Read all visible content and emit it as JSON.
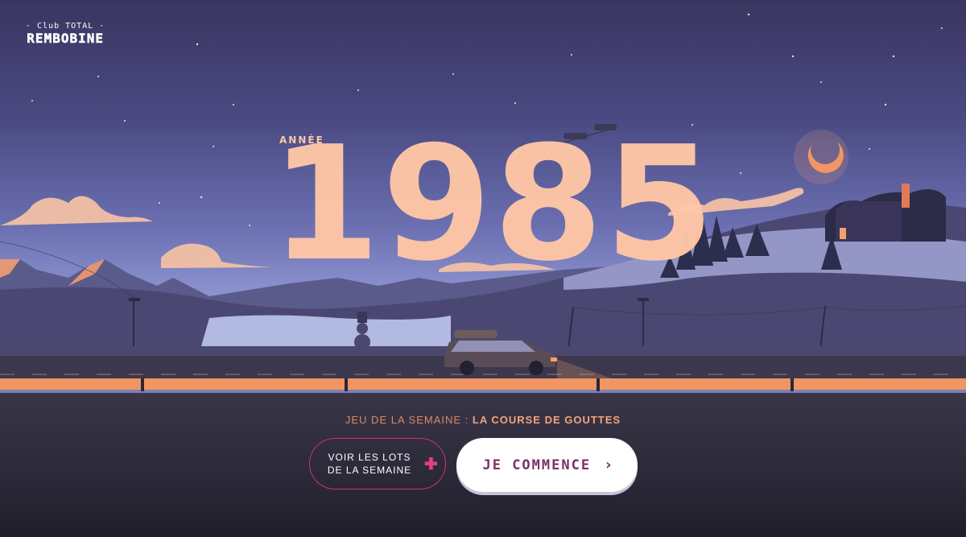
{
  "logo": {
    "line1": "· Club TOTAL ·",
    "line2": "REMBOBINE"
  },
  "hero": {
    "year_label": "ANNÉE",
    "year": "1985"
  },
  "game": {
    "label": "JEU DE LA SEMAINE :",
    "name": "LA COURSE DE GOUTTES"
  },
  "buttons": {
    "lots_line1": "VOIR LES LOTS",
    "lots_line2": "DE LA SEMAINE",
    "lots_icon": "plus-icon",
    "start_label": "JE COMMENCE",
    "start_icon": "chevron-right-icon"
  },
  "colors": {
    "year": "#ffc6a6",
    "accent_pink": "#e0427a",
    "accent_orange": "#f1a57a",
    "start_text": "#7a2e6a"
  }
}
